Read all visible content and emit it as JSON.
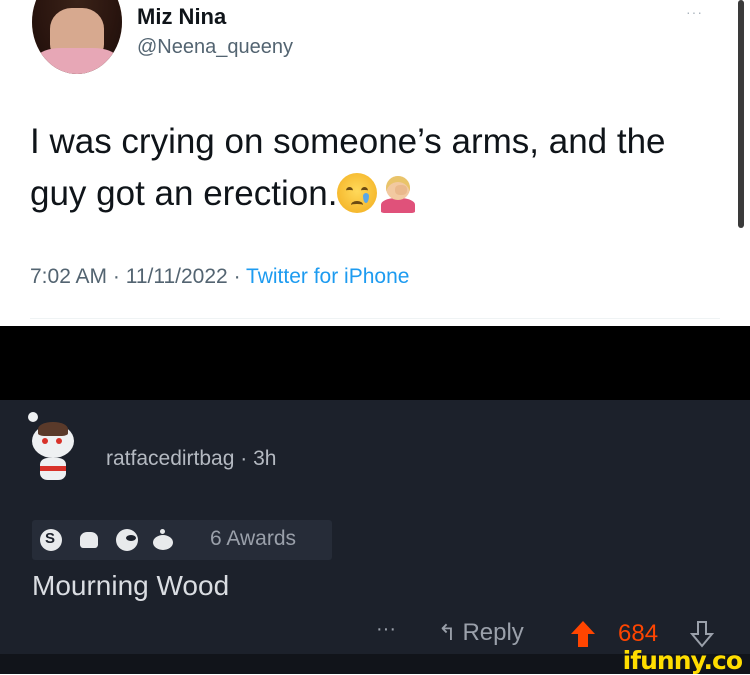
{
  "tweet": {
    "display_name": "Miz Nina",
    "handle": "@Neena_queeny",
    "more_label": "···",
    "text": "I was crying on someone’s arms, and the guy got an erection.",
    "emojis": [
      "crying-face",
      "person-facepalming"
    ],
    "time": "7:02 AM",
    "date": "11/11/2022",
    "separator": " · ",
    "source": "Twitter for iPhone"
  },
  "comment": {
    "username": "ratfacedirtbag",
    "age": "3h",
    "separator": " · ",
    "awards": [
      "silver-award-icon",
      "wholesome-award-icon",
      "helpful-award-icon",
      "snoo-award-icon"
    ],
    "awards_label": "6 Awards",
    "body": "Mourning Wood",
    "more_label": "···",
    "reply_label": "Reply",
    "score": "684"
  },
  "colors": {
    "upvote": "#ff4500",
    "dark_bg": "#1c212b",
    "link": "#1d9bf0",
    "watermark": "#ffdd00"
  },
  "watermark": "ifunny.co"
}
